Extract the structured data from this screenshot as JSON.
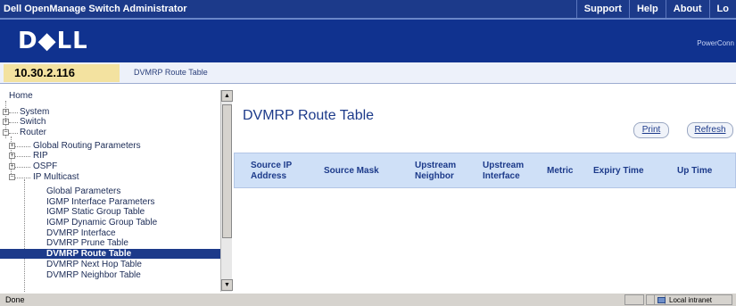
{
  "header": {
    "app_title": "Dell OpenManage Switch Administrator",
    "nav": [
      "Support",
      "Help",
      "About",
      "Lo"
    ],
    "logo": "D◆LL",
    "product": "PowerConn"
  },
  "ipbar": {
    "ip": "10.30.2.116",
    "breadcrumb": "DVMRP Route Table"
  },
  "tree": [
    {
      "label": "Home"
    },
    {
      "label": "System"
    },
    {
      "label": "Switch"
    },
    {
      "label": "Router"
    },
    {
      "label": "Global Routing Parameters"
    },
    {
      "label": "RIP"
    },
    {
      "label": "OSPF"
    },
    {
      "label": "IP Multicast"
    },
    {
      "label": "Global Parameters"
    },
    {
      "label": "IGMP Interface Parameters"
    },
    {
      "label": "IGMP Static Group Table"
    },
    {
      "label": "IGMP Dynamic Group Table"
    },
    {
      "label": "DVMRP Interface"
    },
    {
      "label": "DVMRP Prune Table"
    },
    {
      "label": "DVMRP Route Table"
    },
    {
      "label": "DVMRP Next Hop Table"
    },
    {
      "label": "DVMRP Neighbor Table"
    }
  ],
  "main": {
    "title": "DVMRP Route Table",
    "print_label": "Print",
    "refresh_label": "Refresh",
    "columns": [
      "Source IP Address",
      "Source Mask",
      "Upstream Neighbor",
      "Upstream Interface",
      "Metric",
      "Expiry Time",
      "Up Time"
    ]
  },
  "status": {
    "text": "Done",
    "zone": "Local intranet"
  },
  "colors": {
    "header_blue": "#1c3a8a",
    "ip_highlight": "#f3e2a0",
    "table_header": "#cfe0f7"
  }
}
